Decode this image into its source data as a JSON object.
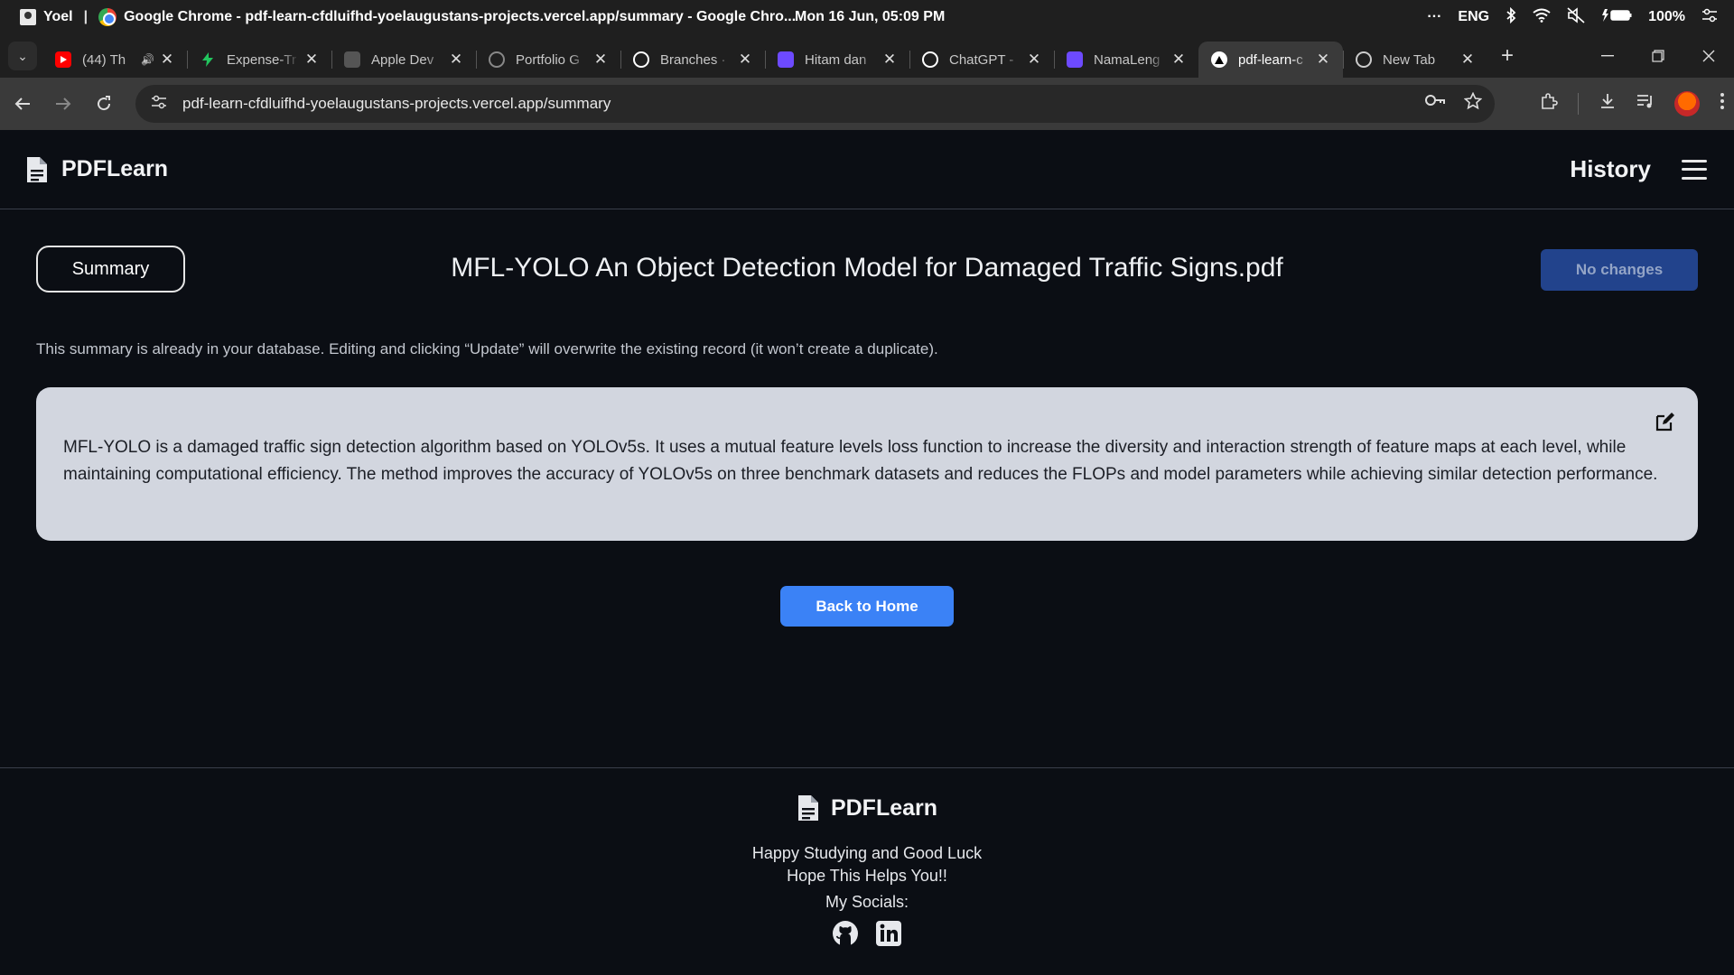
{
  "os": {
    "user": "Yoel",
    "separator": "|",
    "window_title": "Google Chrome  -  pdf-learn-cfdluifhd-yoelaugustans-projects.vercel.app/summary - Google Chro...",
    "clock": "Mon 16 Jun, 05:09 PM",
    "overflow": "···",
    "language": "ENG",
    "battery": "100%"
  },
  "tabs": [
    {
      "title": "(44) Th",
      "favicon": "youtube-icon",
      "color": "#ff0000",
      "audio": true
    },
    {
      "title": "Expense-Tr",
      "favicon": "bolt-icon",
      "color": "#22c55e"
    },
    {
      "title": "Apple Dev",
      "favicon": "apple-dev-icon",
      "color": "#555555"
    },
    {
      "title": "Portfolio G",
      "favicon": "globe-icon",
      "color": "#888888"
    },
    {
      "title": "Branches ·",
      "favicon": "github-icon",
      "color": "#ffffff"
    },
    {
      "title": "Hitam dan",
      "favicon": "canva-icon",
      "color": "#6d4aff"
    },
    {
      "title": "ChatGPT -",
      "favicon": "chatgpt-icon",
      "color": "#ffffff"
    },
    {
      "title": "NamaLeng",
      "favicon": "canva-icon",
      "color": "#6d4aff"
    },
    {
      "title": "pdf-learn-c",
      "favicon": "vercel-icon",
      "color": "#ffffff",
      "active": true
    },
    {
      "title": "New Tab",
      "favicon": "chrome-icon",
      "color": "#cccccc"
    }
  ],
  "address": {
    "url": "pdf-learn-cfdluifhd-yoelaugustans-projects.vercel.app/summary"
  },
  "header": {
    "brand": "PDFLearn",
    "history": "History"
  },
  "main": {
    "summary_label": "Summary",
    "document_title": "MFL-YOLO An Object Detection Model for Damaged Traffic Signs.pdf",
    "status_button": "No changes",
    "notice": "This summary is already in your database. Editing and clicking “Update” will overwrite the existing record (it won’t create a duplicate).",
    "summary_text": "MFL-YOLO is a damaged traffic sign detection algorithm based on YOLOv5s. It uses a mutual feature levels loss function to increase the diversity and interaction strength of feature maps at each level, while maintaining computational efficiency. The method improves the accuracy of YOLOv5s on three benchmark datasets and reduces the FLOPs and model parameters while achieving similar detection performance.",
    "back_button": "Back to Home"
  },
  "footer": {
    "brand": "PDFLearn",
    "line1": "Happy Studying and Good Luck",
    "line2": "Hope This Helps You!!",
    "socials_label": "My Socials:"
  },
  "colors": {
    "page_bg": "#0b0e14",
    "card_bg": "#d2d6df",
    "primary": "#3b82f6",
    "disabled_button": "#22438c"
  }
}
